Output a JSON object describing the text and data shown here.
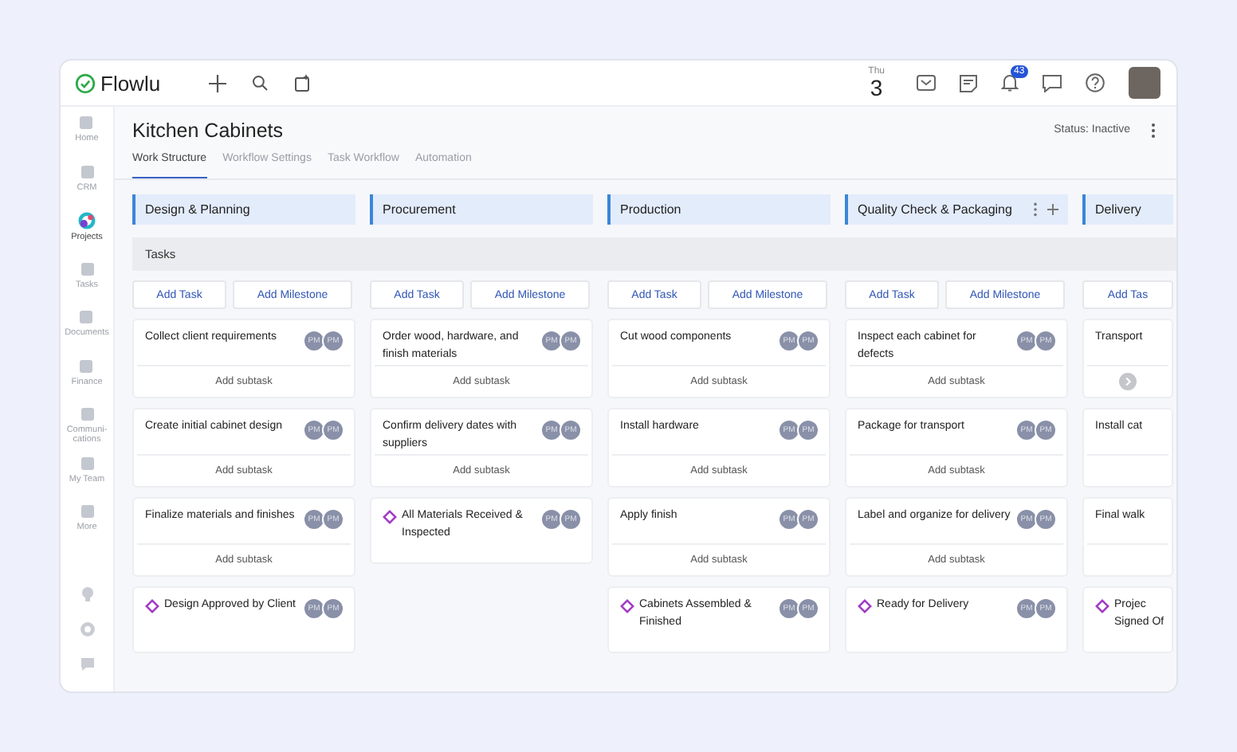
{
  "topbar": {
    "logo": "Flowlu",
    "day": "Thu",
    "date": "3",
    "notifications": "43"
  },
  "sidebar": {
    "items": [
      {
        "label": "Home",
        "selected": false
      },
      {
        "label": "CRM",
        "selected": false
      },
      {
        "label": "Projects",
        "selected": true
      },
      {
        "label": "Tasks",
        "selected": false
      },
      {
        "label": "Documents",
        "selected": false
      },
      {
        "label": "Finance",
        "selected": false
      },
      {
        "label": "Communi-\ncations",
        "selected": false
      },
      {
        "label": "My Team",
        "selected": false
      },
      {
        "label": "More",
        "selected": false
      }
    ]
  },
  "project": {
    "title": "Kitchen Cabinets",
    "status": "Status: Inactive"
  },
  "tabs": [
    {
      "label": "Work Structure",
      "selected": true
    },
    {
      "label": "Workflow Settings",
      "selected": false
    },
    {
      "label": "Task Workflow",
      "selected": false
    },
    {
      "label": "Automation",
      "selected": false
    }
  ],
  "tasks_label": "Tasks",
  "stages": [
    {
      "name": "Design & Planning",
      "actions": false,
      "add_task": "Add Task",
      "add_milestone": "Add Milestone",
      "cards": [
        {
          "kind": "task",
          "title": "Collect client requirements",
          "assignees": [
            "PM",
            "PM"
          ],
          "subtask": "Add subtask"
        },
        {
          "kind": "task",
          "title": "Create initial cabinet design",
          "assignees": [
            "PM",
            "PM"
          ],
          "subtask": "Add subtask"
        },
        {
          "kind": "task",
          "title": "Finalize materials and finishes",
          "assignees": [
            "PM",
            "PM"
          ],
          "subtask": "Add subtask"
        },
        {
          "kind": "milestone",
          "title": "Design Approved by Client",
          "assignees": [
            "PM",
            "PM"
          ]
        }
      ]
    },
    {
      "name": "Procurement",
      "actions": false,
      "add_task": "Add Task",
      "add_milestone": "Add Milestone",
      "cards": [
        {
          "kind": "task",
          "title": "Order wood, hardware, and finish materials",
          "assignees": [
            "PM",
            "PM"
          ],
          "subtask": "Add subtask"
        },
        {
          "kind": "task",
          "title": "Confirm delivery dates with suppliers",
          "assignees": [
            "PM",
            "PM"
          ],
          "subtask": "Add subtask"
        },
        {
          "kind": "milestone",
          "title": "All Materials Received & Inspected",
          "assignees": [
            "PM",
            "PM"
          ]
        }
      ]
    },
    {
      "name": "Production",
      "actions": false,
      "add_task": "Add Task",
      "add_milestone": "Add Milestone",
      "cards": [
        {
          "kind": "task",
          "title": "Cut wood components",
          "assignees": [
            "PM",
            "PM"
          ],
          "subtask": "Add subtask"
        },
        {
          "kind": "task",
          "title": "Install hardware",
          "assignees": [
            "PM",
            "PM"
          ],
          "subtask": "Add subtask"
        },
        {
          "kind": "task",
          "title": "Apply finish",
          "assignees": [
            "PM",
            "PM"
          ],
          "subtask": "Add subtask"
        },
        {
          "kind": "milestone",
          "title": "Cabinets Assembled & Finished",
          "assignees": [
            "PM",
            "PM"
          ]
        }
      ]
    },
    {
      "name": "Quality Check & Packaging",
      "actions": true,
      "add_task": "Add Task",
      "add_milestone": "Add Milestone",
      "cards": [
        {
          "kind": "task",
          "title": "Inspect each cabinet for defects",
          "assignees": [
            "PM",
            "PM"
          ],
          "subtask": "Add subtask"
        },
        {
          "kind": "task",
          "title": "Package for transport",
          "assignees": [
            "PM",
            "PM"
          ],
          "subtask": "Add subtask"
        },
        {
          "kind": "task",
          "title": "Label and organize for delivery",
          "assignees": [
            "PM",
            "PM"
          ],
          "subtask": "Add subtask"
        },
        {
          "kind": "milestone",
          "title": "Ready for Delivery",
          "assignees": [
            "PM",
            "PM"
          ]
        }
      ]
    },
    {
      "name": "Delivery",
      "actions": false,
      "add_task": "Add Tas",
      "cards": [
        {
          "kind": "task",
          "title": "Transport",
          "scroll": true
        },
        {
          "kind": "task",
          "title": "Install cat",
          "scroll": false
        },
        {
          "kind": "task",
          "title": "Final walk",
          "scroll": false
        },
        {
          "kind": "milestone",
          "title": "Projec\nSigned Of"
        }
      ]
    }
  ]
}
